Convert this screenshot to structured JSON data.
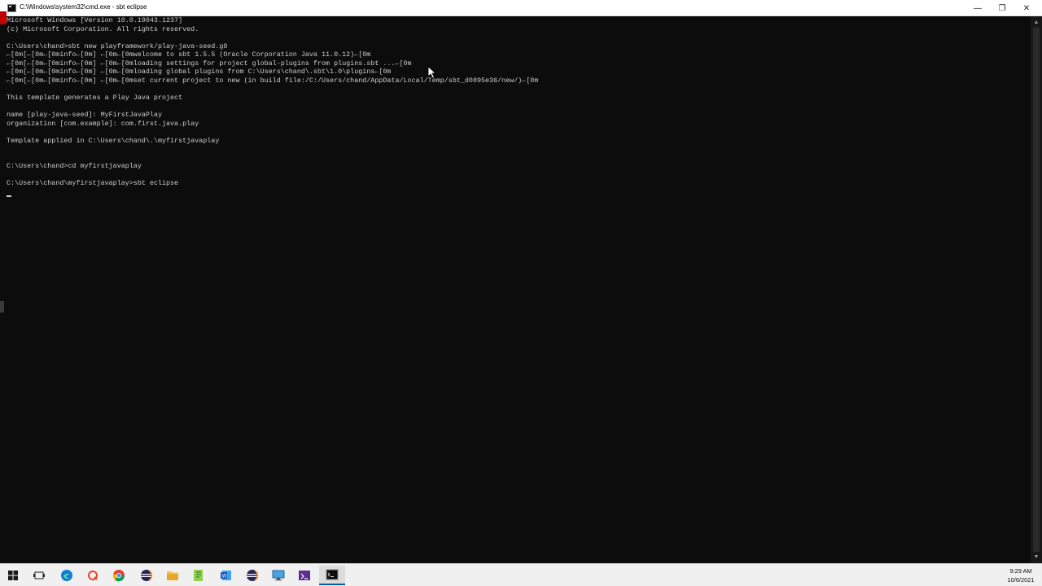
{
  "window": {
    "title": "C:\\Windows\\system32\\cmd.exe - sbt  eclipse",
    "minimize_glyph": "—",
    "maximize_glyph": "❐",
    "close_glyph": "✕"
  },
  "terminal": {
    "lines": [
      "Microsoft Windows [Version 10.0.19043.1237]",
      "(c) Microsoft Corporation. All rights reserved.",
      "",
      "C:\\Users\\chand>sbt new playframework/play-java-seed.g8",
      "←[0m[←[0m←[0minfo←[0m] ←[0m←[0mwelcome to sbt 1.5.5 (Oracle Corporation Java 11.0.12)←[0m",
      "←[0m[←[0m←[0minfo←[0m] ←[0m←[0mloading settings for project global-plugins from plugins.sbt ...←[0m",
      "←[0m[←[0m←[0minfo←[0m] ←[0m←[0mloading global plugins from C:\\Users\\chand\\.sbt\\1.0\\plugins←[0m",
      "←[0m[←[0m←[0minfo←[0m] ←[0m←[0mset current project to new (in build file:/C:/Users/chand/AppData/Local/Temp/sbt_d0895e36/new/)←[0m",
      "",
      "This template generates a Play Java project",
      "",
      "name [play-java-seed]: MyFirstJavaPlay",
      "organization [com.example]: com.first.java.play",
      "",
      "Template applied in C:\\Users\\chand\\.\\myfirstjavaplay",
      "",
      "",
      "C:\\Users\\chand>cd myfirstjavaplay",
      "",
      "C:\\Users\\chand\\myfirstjavaplay>sbt eclipse"
    ],
    "text_color": "#cccccc",
    "background": "#0c0c0c"
  },
  "scrollbar": {
    "up_glyph": "▲",
    "down_glyph": "▼"
  },
  "taskbar": {
    "items": [
      {
        "name": "start-button",
        "icon": "windows-logo-icon"
      },
      {
        "name": "task-view-button",
        "icon": "task-view-icon"
      },
      {
        "name": "edge-button",
        "icon": "edge-icon"
      },
      {
        "name": "search-app-button",
        "icon": "q-icon"
      },
      {
        "name": "chrome-button",
        "icon": "chrome-icon"
      },
      {
        "name": "eclipse-button",
        "icon": "eclipse-icon"
      },
      {
        "name": "file-explorer-button",
        "icon": "folder-icon"
      },
      {
        "name": "notepad-plus-button",
        "icon": "notepad-icon"
      },
      {
        "name": "word-button",
        "icon": "word-icon"
      },
      {
        "name": "eclipse-2-button",
        "icon": "eclipse-icon"
      },
      {
        "name": "remote-desktop-button",
        "icon": "remote-desktop-icon"
      },
      {
        "name": "visual-studio-button",
        "icon": "visual-studio-icon"
      },
      {
        "name": "cmd-button",
        "icon": "cmd-icon"
      }
    ],
    "time": "9:29 AM",
    "date": "10/6/2021",
    "accent": "#0063b1"
  }
}
